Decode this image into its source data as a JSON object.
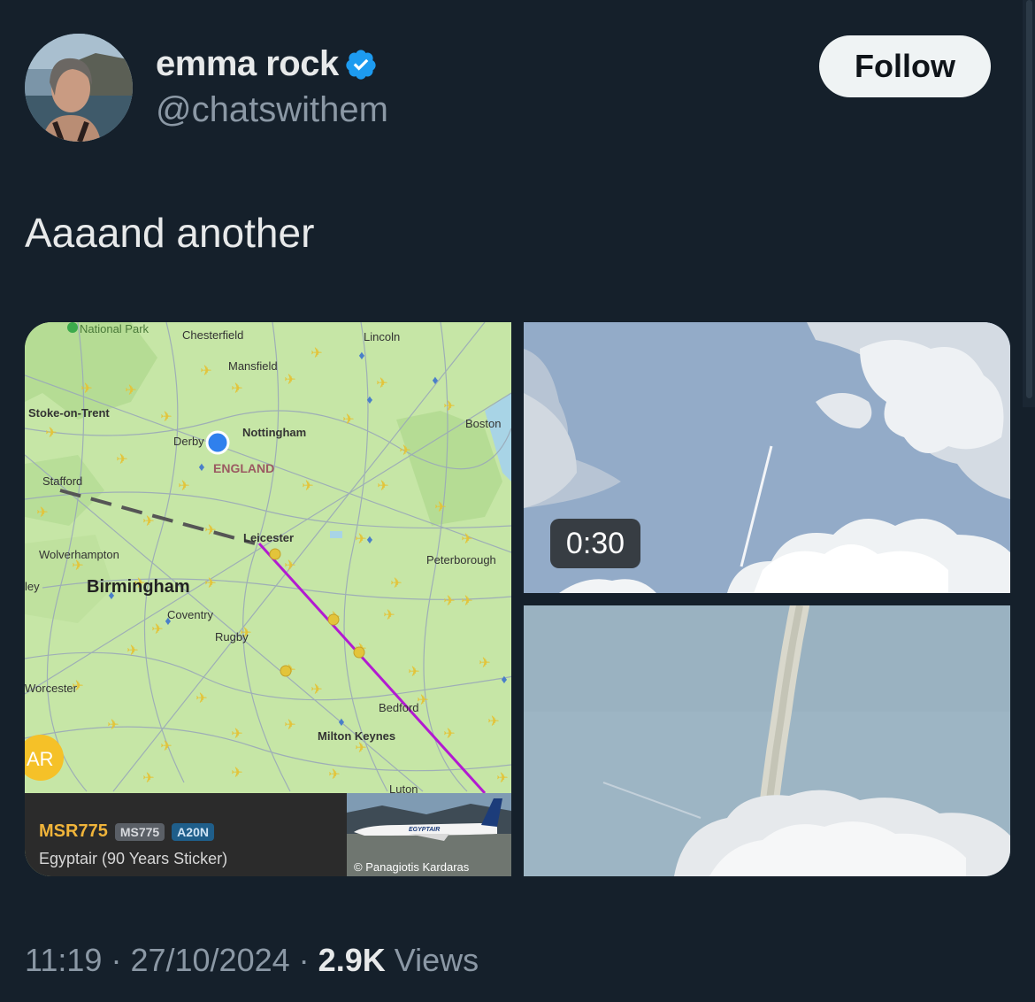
{
  "author": {
    "name": "emma rock",
    "handle": "@chatswithem",
    "follow_label": "Follow"
  },
  "tweet": {
    "text": "Aaaand another"
  },
  "media": {
    "map": {
      "labels": [
        "National Park",
        "Chesterfield",
        "Lincoln",
        "Mansfield",
        "Stoke-on-Trent",
        "Boston",
        "Derby",
        "Nottingham",
        "ENGLAND",
        "Stafford",
        "Leicester",
        "Wolverhampton",
        "Peterborough",
        "Birmingham",
        "Coventry",
        "Rugby",
        "Worcester",
        "Bedford",
        "Milton Keynes",
        "Luton",
        "ley",
        "AR"
      ],
      "flight": {
        "callsign": "MSR775",
        "code": "MS775",
        "aircraft": "A20N",
        "airline": "Egyptair (90 Years Sticker)",
        "photo_credit": "© Panagiotis Kardaras",
        "livery_text": "EGYPTAIR"
      }
    },
    "video": {
      "duration": "0:30"
    }
  },
  "footer": {
    "time": "11:19",
    "date": "27/10/2024",
    "views_count": "2.9K",
    "views_label": "Views",
    "separator": "·"
  },
  "colors": {
    "background": "#15202b",
    "verified": "#1d9bf0",
    "flight_path": "#b21ad1",
    "callsign": "#f0b43a"
  }
}
